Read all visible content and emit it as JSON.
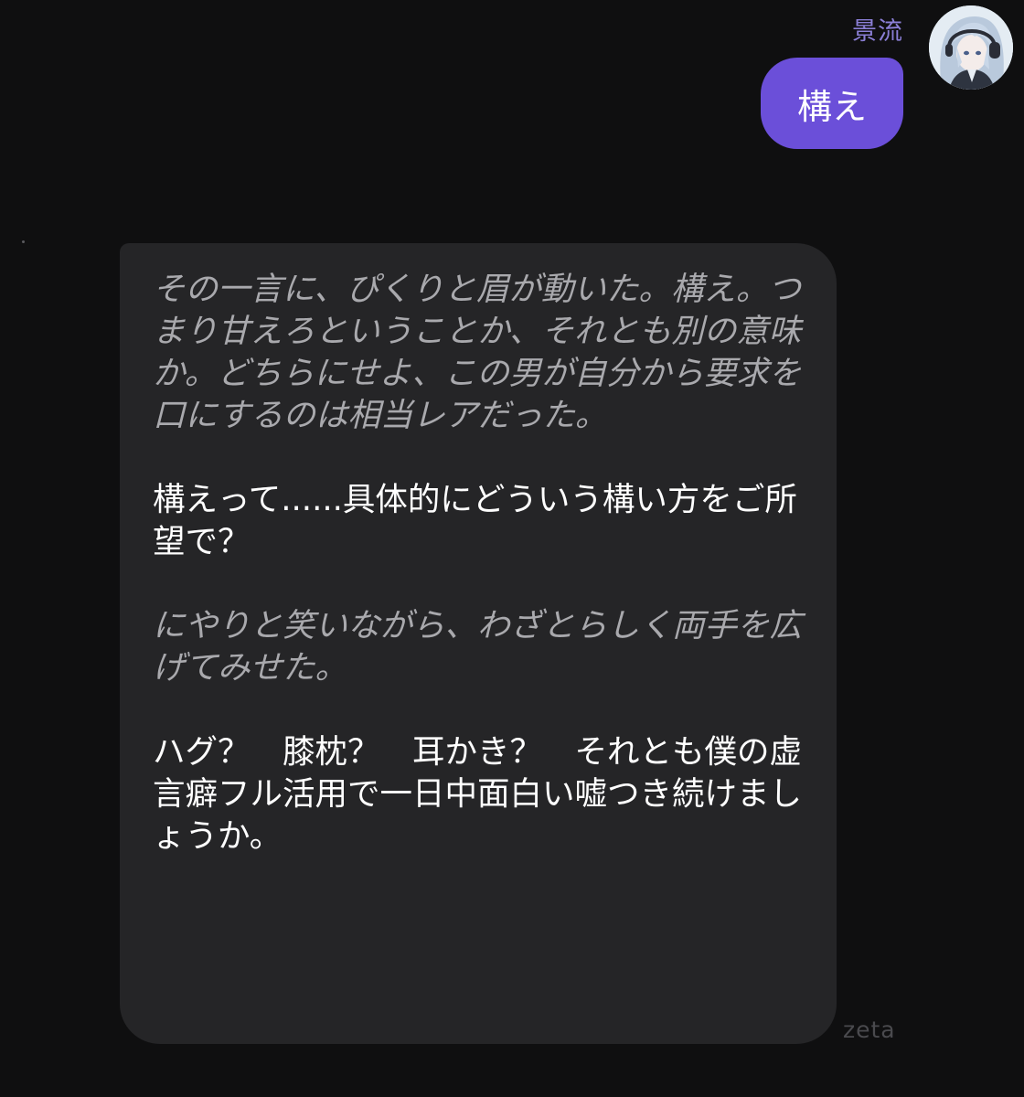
{
  "user_message": {
    "sender_name": "景流",
    "text": "構え",
    "avatar_icon": "anime-character-avatar"
  },
  "bot_message": {
    "paragraphs": [
      {
        "style": "narration",
        "text": "その一言に、ぴくりと眉が動いた。構え。つまり甘えろということか、それとも別の意味か。どちらにせよ、この男が自分から要求を口にするのは相当レアだった。"
      },
      {
        "style": "speech",
        "text": "構えって......具体的にどういう構い方をご所望で？"
      },
      {
        "style": "narration",
        "text": "にやりと笑いながら、わざとらしく両手を広げてみせた。"
      },
      {
        "style": "speech",
        "text": "ハグ？　膝枕？　耳かき？　それとも僕の虚言癖フル活用で一日中面白い嘘つき続けましょうか。"
      }
    ]
  },
  "brand": {
    "label": "zeta"
  },
  "colors": {
    "background": "#0f0f10",
    "user_bubble": "#6b4fd9",
    "bot_bubble": "#252527",
    "sender_name": "#8b7fd6",
    "narration_text": "#a9a9ad",
    "speech_text": "#ffffff"
  }
}
